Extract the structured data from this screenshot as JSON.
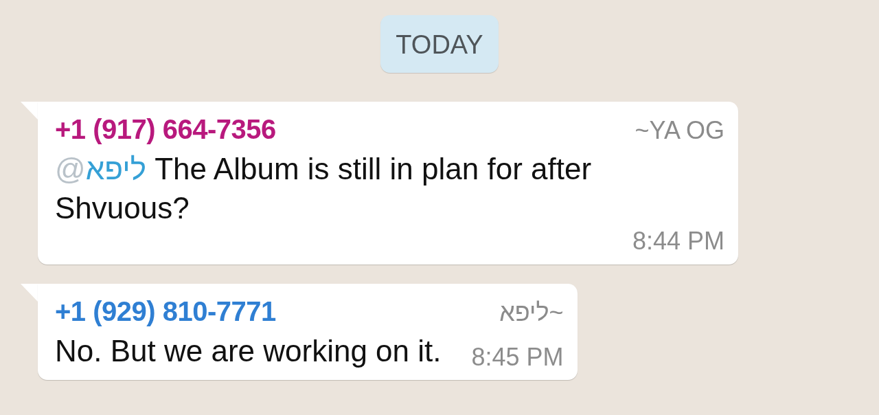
{
  "date_chip": "TODAY",
  "messages": [
    {
      "sender": "+1 (917) 664-7356",
      "color": "#b8197d",
      "push_name": "~YA OG",
      "mention": {
        "at": "@",
        "name": "ליפא"
      },
      "text": "The Album is still in plan for after Shvuous?",
      "time": "8:44 PM"
    },
    {
      "sender": "+1 (929) 810-7771",
      "color": "#2f7fd3",
      "push_name": "~ליפא",
      "text": "No. But we are working on it.",
      "time": "8:45 PM"
    }
  ]
}
